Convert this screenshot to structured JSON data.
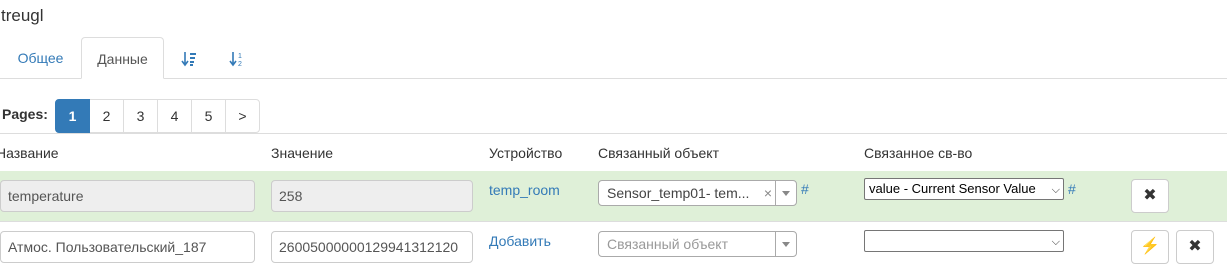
{
  "page": {
    "title": "treugl"
  },
  "tabs": [
    {
      "label": "Общее",
      "active": false
    },
    {
      "label": "Данные",
      "active": true
    }
  ],
  "sort_tabs": [
    {
      "icon": "sort-amount-asc-icon",
      "glyph": "⬇≡"
    },
    {
      "icon": "sort-numeric-asc-icon",
      "glyph": "⬇⁑"
    }
  ],
  "pager": {
    "label": "Pages:",
    "pages": [
      "1",
      "2",
      "3",
      "4",
      "5",
      ">"
    ],
    "current": "1"
  },
  "table": {
    "columns": [
      "Название",
      "Значение",
      "Устройство",
      "Связанный объект",
      "Связанное св-во"
    ],
    "rows": [
      {
        "name": "temperature",
        "value": "258",
        "device": "temp_room",
        "linked_object": "Sensor_temp01- tem...",
        "linked_object_clear": "×",
        "linked_object_hash": "#",
        "linked_property": "value - Current Sensor Value",
        "linked_property_hash": "#",
        "delete_glyph": "✖"
      },
      {
        "name": "Атмос. Пользовательский_187",
        "value": "26005000000129941312120",
        "device": "Добавить",
        "linked_object_placeholder": "Связанный объект",
        "linked_property": "",
        "action_glyph": "⚡",
        "delete_glyph": "✖"
      }
    ]
  },
  "colors": {
    "link": "#337ab7",
    "active_page": "#337ab7",
    "success_row": "#dff0d8"
  }
}
